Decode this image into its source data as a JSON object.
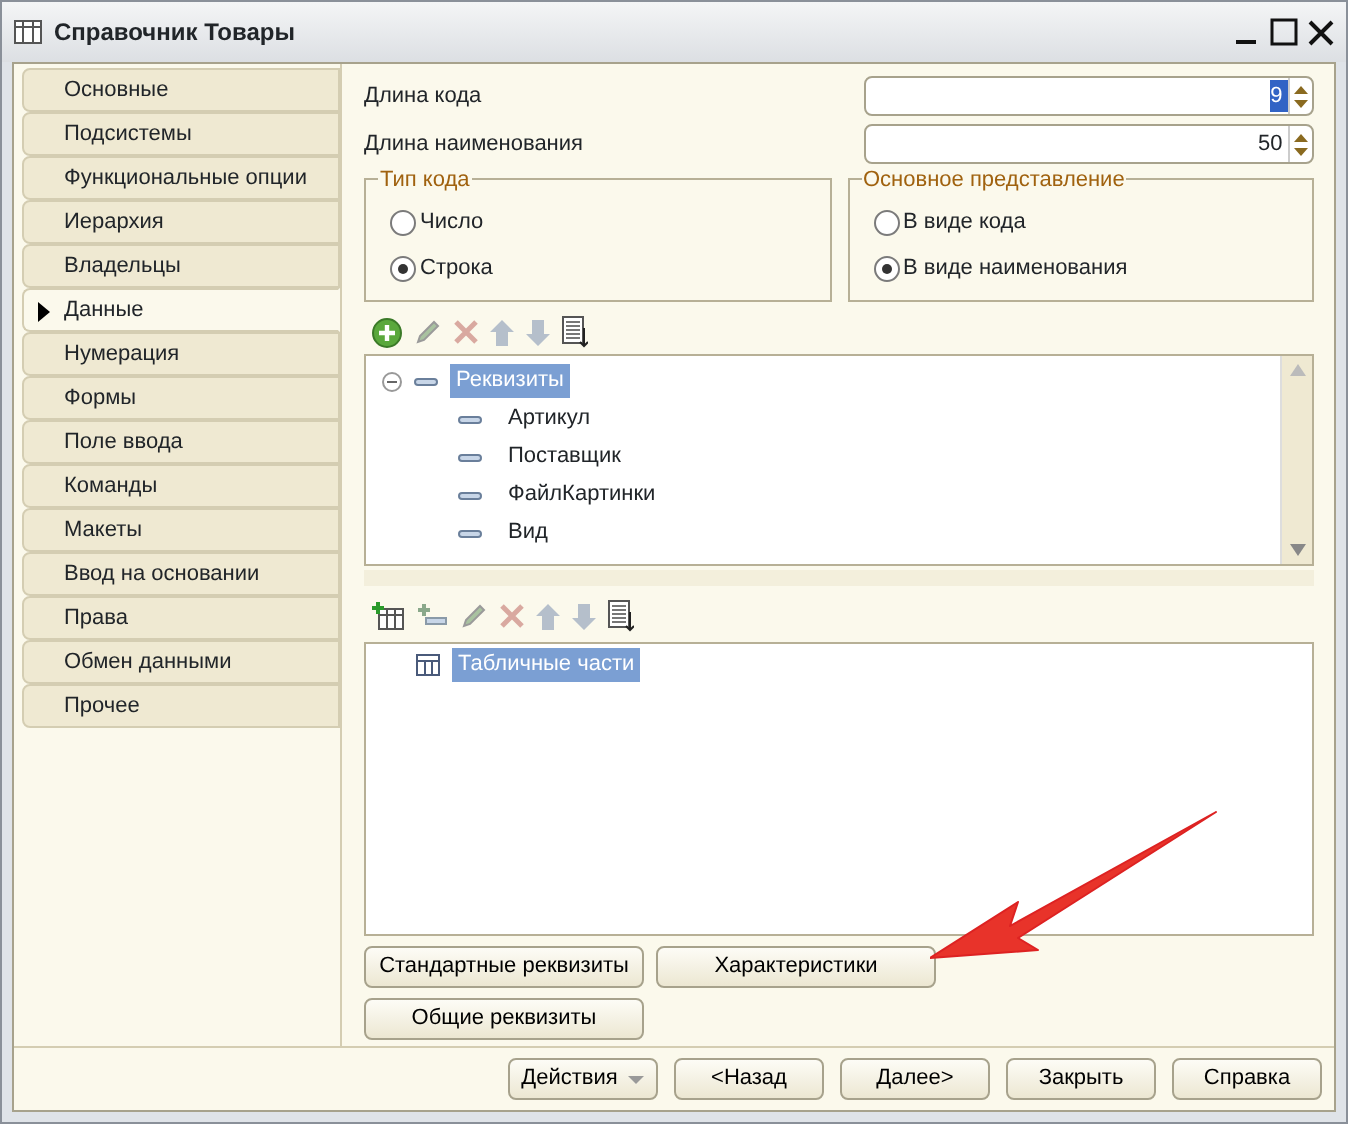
{
  "window": {
    "title": "Справочник Товары"
  },
  "tabs": [
    {
      "label": "Основные",
      "selected": false
    },
    {
      "label": "Подсистемы",
      "selected": false
    },
    {
      "label": "Функциональные опции",
      "selected": false
    },
    {
      "label": "Иерархия",
      "selected": false
    },
    {
      "label": "Владельцы",
      "selected": false
    },
    {
      "label": "Данные",
      "selected": true
    },
    {
      "label": "Нумерация",
      "selected": false
    },
    {
      "label": "Формы",
      "selected": false
    },
    {
      "label": "Поле ввода",
      "selected": false
    },
    {
      "label": "Команды",
      "selected": false
    },
    {
      "label": "Макеты",
      "selected": false
    },
    {
      "label": "Ввод на основании",
      "selected": false
    },
    {
      "label": "Права",
      "selected": false
    },
    {
      "label": "Обмен данными",
      "selected": false
    },
    {
      "label": "Прочее",
      "selected": false
    }
  ],
  "fields": [
    {
      "label": "Длина кода",
      "value": "9",
      "selected": true
    },
    {
      "label": "Длина наименования",
      "value": "50",
      "selected": false
    }
  ],
  "groups": [
    {
      "title": "Тип кода",
      "options": [
        {
          "label": "Число",
          "selected": false
        },
        {
          "label": "Строка",
          "selected": true
        }
      ]
    },
    {
      "title": "Основное представление",
      "options": [
        {
          "label": "В виде кода",
          "selected": false
        },
        {
          "label": "В виде наименования",
          "selected": true
        }
      ]
    }
  ],
  "attributes_tree": {
    "items": [
      {
        "label": "Реквизиты",
        "selected": true,
        "expanded": true,
        "children": [
          {
            "label": "Артикул"
          },
          {
            "label": "Поставщик"
          },
          {
            "label": "ФайлКартинки"
          },
          {
            "label": "Вид"
          }
        ]
      }
    ]
  },
  "tabular_sections": {
    "items": [
      {
        "label": "Табличные части",
        "selected": true
      }
    ]
  },
  "side_buttons": [
    {
      "label": "Стандартные реквизиты"
    },
    {
      "label": "Характеристики"
    },
    {
      "label": "Общие реквизиты"
    }
  ],
  "footer_buttons": [
    {
      "label": "Действия",
      "kind": "dropdown"
    },
    {
      "label": "<Назад",
      "kind": "plain"
    },
    {
      "label": "Далее>",
      "kind": "plain"
    },
    {
      "label": "Закрыть",
      "kind": "plain"
    },
    {
      "label": "Справка",
      "kind": "plain"
    }
  ]
}
